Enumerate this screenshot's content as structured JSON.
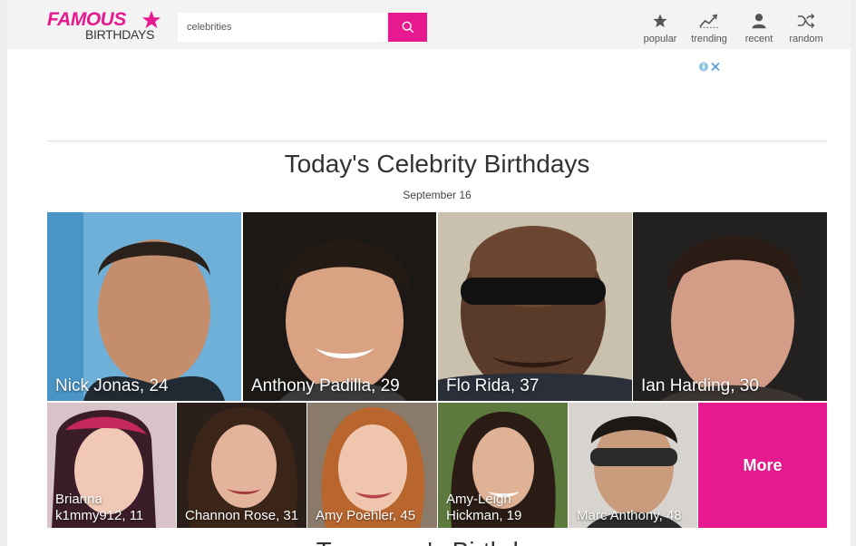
{
  "header": {
    "logo": {
      "top": "FAMOUS",
      "bottom": "BIRTHDAYS"
    },
    "search": {
      "value": "celebrities",
      "placeholder": ""
    },
    "nav": [
      {
        "label": "popular",
        "icon": "star-icon"
      },
      {
        "label": "trending",
        "icon": "trending-icon"
      },
      {
        "label": "recent",
        "icon": "person-icon"
      },
      {
        "label": "random",
        "icon": "shuffle-icon"
      }
    ]
  },
  "main": {
    "title": "Today's Celebrity Birthdays",
    "date": "September 16",
    "featured": [
      {
        "caption": "Nick Jonas, 24"
      },
      {
        "caption": "Anthony Padilla, 29"
      },
      {
        "caption": "Flo Rida, 37"
      },
      {
        "caption": "Ian Harding, 30"
      }
    ],
    "row2": [
      {
        "caption": "Brianna k1mmy912, 11"
      },
      {
        "caption": "Channon Rose, 31"
      },
      {
        "caption": "Amy Poehler, 45"
      },
      {
        "caption": "Amy-Leigh Hickman, 19"
      },
      {
        "caption": "Marc Anthony, 48"
      }
    ],
    "more_label": "More",
    "next_section_title": "Tomorrow's Birthdays"
  },
  "colors": {
    "brand": "#e6198f",
    "header_bg": "#f3f3f3"
  }
}
